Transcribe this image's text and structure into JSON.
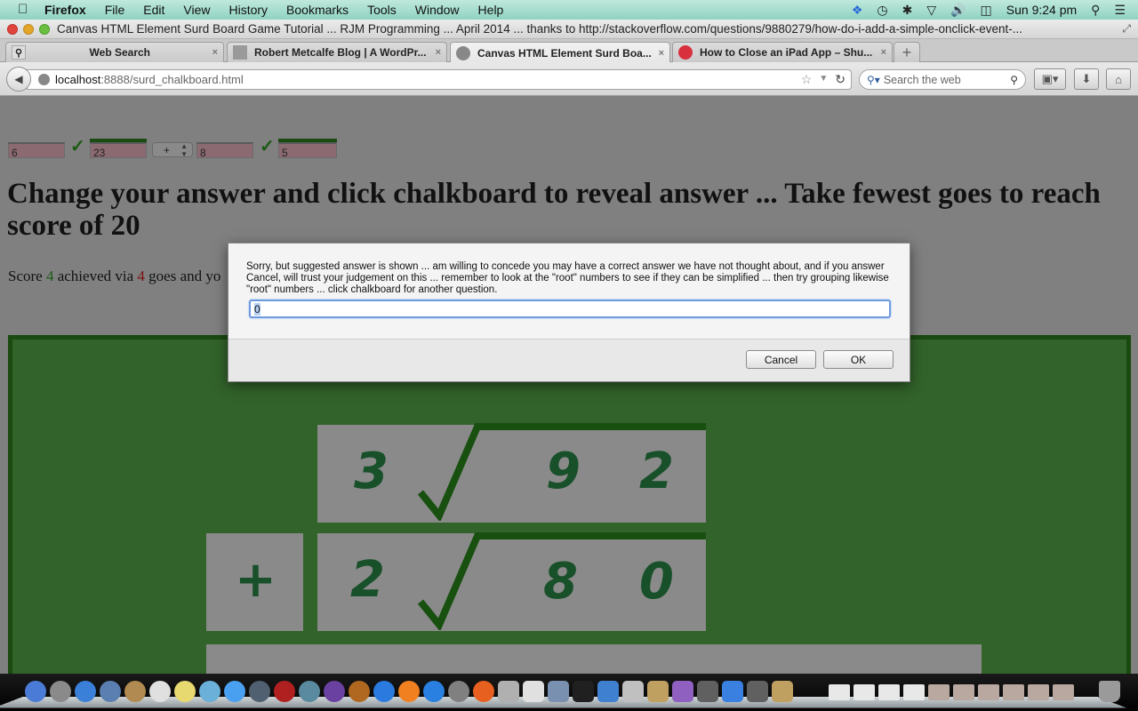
{
  "menubar": {
    "apple": "",
    "app": "Firefox",
    "items": [
      "File",
      "Edit",
      "View",
      "History",
      "Bookmarks",
      "Tools",
      "Window",
      "Help"
    ],
    "clock": "Sun 9:24 pm"
  },
  "window": {
    "title": "Canvas HTML Element Surd Board Game Tutorial ... RJM Programming ... April 2014 ... thanks to http://stackoverflow.com/questions/9880279/how-do-i-add-a-simple-onclick-event-..."
  },
  "tabs": [
    {
      "label": "Web Search",
      "icon": "search-icon"
    },
    {
      "label": "Robert Metcalfe Blog | A WordPr...",
      "icon": "blog-favicon"
    },
    {
      "label": "Canvas HTML Element Surd Boa...",
      "icon": "globe-icon",
      "active": true
    },
    {
      "label": "How to Close an iPad App – Shu...",
      "icon": "red-circle-favicon"
    }
  ],
  "newtab": "+",
  "tab_close": "×",
  "navbar": {
    "url_host": "localhost",
    "url_rest": ":8888/surd_chalkboard.html",
    "search_placeholder": "Search the web"
  },
  "page": {
    "controls": {
      "coef1": "6",
      "radicand1": "23",
      "operator": "+",
      "coef2": "8",
      "radicand2": "5"
    },
    "heading": "Change your answer and click chalkboard to reveal answer ... Take fewest goes to reach score of 20",
    "score": {
      "prefix": "Score ",
      "score": "4",
      "mid": " achieved via ",
      "goes": "4",
      "suffix": " goes and yo"
    },
    "board": {
      "row1": {
        "coef": "3",
        "radicand": [
          "9",
          "2"
        ]
      },
      "row2": {
        "op": "+",
        "coef": "2",
        "radicand": [
          "8",
          "0"
        ]
      }
    }
  },
  "dialog": {
    "message": "Sorry, but suggested answer is shown ... am willing to concede you may have a correct answer we have not thought about, and if you answer Cancel, will trust your judgement on this ... remember to look at the \"root\" numbers to see if they can be simplified ... then try grouping likewise \"root\" numbers ... click chalkboard for another question.",
    "value": "0",
    "cancel": "Cancel",
    "ok": "OK"
  },
  "dock": {
    "apps": [
      "Finder",
      "Launchpad",
      "Safari",
      "Preview",
      "Contacts",
      "Calendar",
      "Notes",
      "Maps",
      "Messages",
      "FaceTime",
      "Photo Booth",
      "iPhoto",
      "iMovie",
      "GarageBand",
      "iTunes",
      "iBooks",
      "App Store",
      "System Preferences",
      "Firefox",
      "Script Editor",
      "TextEdit",
      "Preview2",
      "Terminal",
      "Fetch",
      "Thunderbird",
      "Filemaker",
      "Seashore",
      "Window",
      "Xcode",
      "Window2",
      "Seashore2"
    ],
    "colors": [
      "#4a7bd6",
      "#8a8a8a",
      "#3a7fd8",
      "#5a7fb0",
      "#b08a50",
      "#e0e0e0",
      "#e8d870",
      "#6ab0d8",
      "#4aa0f0",
      "#506070",
      "#b02020",
      "#5a8aa0",
      "#6a40a0",
      "#b06820",
      "#2a7ae0",
      "#f08020",
      "#2a80e0",
      "#808080",
      "#e86020",
      "#b0b0b0",
      "#e0e0e0",
      "#7a90b0",
      "#202020",
      "#4080d0",
      "#c0c0c0",
      "#c0a060",
      "#9060c0",
      "#606060",
      "#3a80e0",
      "#606060",
      "#c0a060"
    ],
    "trash": "Trash"
  }
}
